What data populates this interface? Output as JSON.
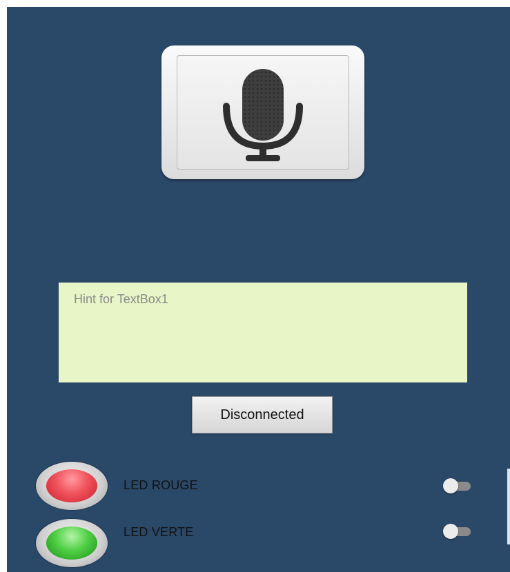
{
  "mic_button": {
    "icon": "microphone-icon"
  },
  "textbox": {
    "placeholder": "Hint for TextBox1",
    "value": ""
  },
  "connection_button": {
    "label": "Disconnected"
  },
  "leds": [
    {
      "label": "LED ROUGE",
      "color": "#f0525c",
      "indicator_icon": "red-led-icon",
      "switch_on": false
    },
    {
      "label": "LED VERTE",
      "color": "#4fcf45",
      "indicator_icon": "green-led-icon",
      "switch_on": false
    }
  ],
  "colors": {
    "background": "#2a4868",
    "textbox_background": "#e8f5c6"
  }
}
